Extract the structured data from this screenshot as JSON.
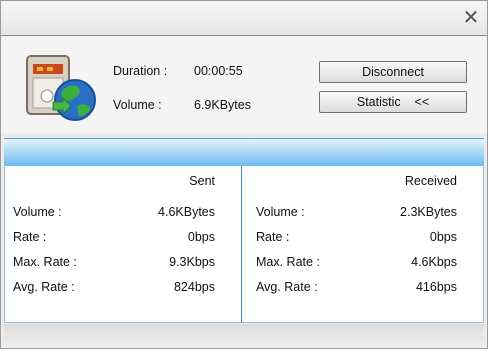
{
  "title_bar": {
    "close_icon": "close-x-icon"
  },
  "connection": {
    "icon": "network-globe-icon",
    "duration_label": "Duration :",
    "duration_value": "00:00:55",
    "volume_label": "Volume :",
    "volume_value": "6.9KBytes"
  },
  "buttons": {
    "disconnect": "Disconnect",
    "statistic": "Statistic    <<"
  },
  "stats": {
    "sent": {
      "header": "Sent",
      "rows": [
        {
          "label": "Volume :",
          "value": "4.6KBytes"
        },
        {
          "label": "Rate :",
          "value": "0bps"
        },
        {
          "label": "Max. Rate :",
          "value": "9.3Kbps"
        },
        {
          "label": "Avg. Rate :",
          "value": "824bps"
        }
      ]
    },
    "received": {
      "header": "Received",
      "rows": [
        {
          "label": "Volume :",
          "value": "2.3KBytes"
        },
        {
          "label": "Rate :",
          "value": "0bps"
        },
        {
          "label": "Max. Rate :",
          "value": "4.6Kbps"
        },
        {
          "label": "Avg. Rate :",
          "value": "416bps"
        }
      ]
    }
  },
  "colors": {
    "accent_blue": "#6cbcf0",
    "divider_blue": "#3a8fd0"
  }
}
